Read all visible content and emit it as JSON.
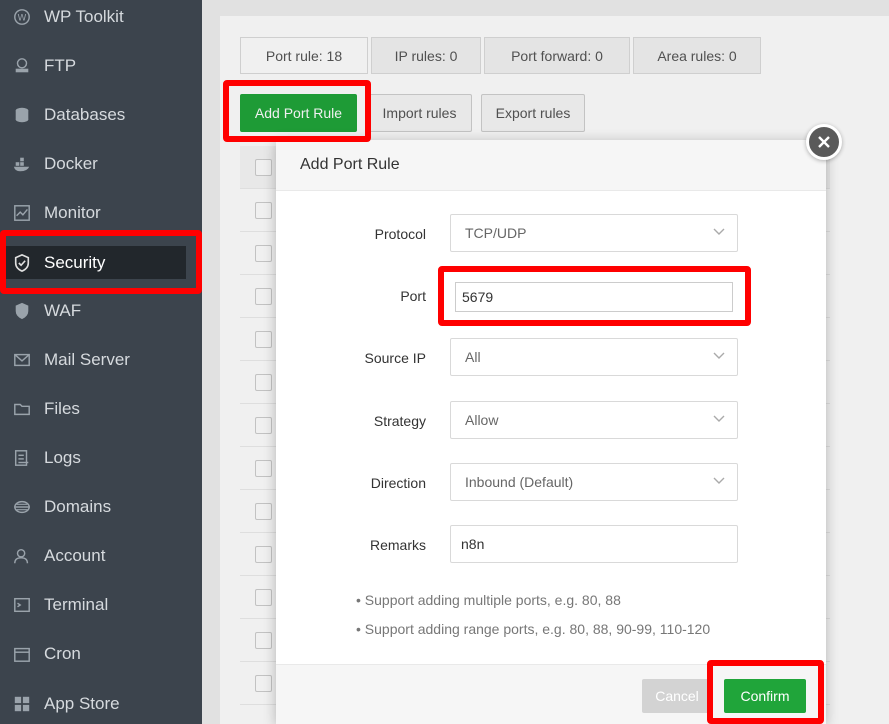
{
  "sidebar": {
    "items": [
      {
        "label": "WP Toolkit",
        "icon": "wordpress-icon"
      },
      {
        "label": "FTP",
        "icon": "ftp-icon"
      },
      {
        "label": "Databases",
        "icon": "database-icon"
      },
      {
        "label": "Docker",
        "icon": "docker-icon"
      },
      {
        "label": "Monitor",
        "icon": "monitor-icon"
      },
      {
        "label": "Security",
        "icon": "shield-icon"
      },
      {
        "label": "WAF",
        "icon": "waf-shield-icon"
      },
      {
        "label": "Mail Server",
        "icon": "mail-icon"
      },
      {
        "label": "Files",
        "icon": "folder-icon"
      },
      {
        "label": "Logs",
        "icon": "logs-icon"
      },
      {
        "label": "Domains",
        "icon": "globe-icon"
      },
      {
        "label": "Account",
        "icon": "user-icon"
      },
      {
        "label": "Terminal",
        "icon": "terminal-icon"
      },
      {
        "label": "Cron",
        "icon": "calendar-icon"
      },
      {
        "label": "App Store",
        "icon": "grid-icon"
      }
    ],
    "active": "Security"
  },
  "tabs": [
    {
      "label": "Port rule: 18"
    },
    {
      "label": "IP rules: 0"
    },
    {
      "label": "Port forward: 0"
    },
    {
      "label": "Area rules: 0"
    }
  ],
  "toolbar": {
    "add_label": "Add Port Rule",
    "import_label": "Import rules",
    "export_label": "Export rules"
  },
  "modal": {
    "title": "Add Port Rule",
    "fields": {
      "protocol": {
        "label": "Protocol",
        "value": "TCP/UDP"
      },
      "port": {
        "label": "Port",
        "value": "5679"
      },
      "source_ip": {
        "label": "Source IP",
        "value": "All"
      },
      "strategy": {
        "label": "Strategy",
        "value": "Allow"
      },
      "direction": {
        "label": "Direction",
        "value": "Inbound (Default)"
      },
      "remarks": {
        "label": "Remarks",
        "value": "n8n"
      }
    },
    "tips": [
      "Support adding multiple ports, e.g. 80, 88",
      "Support adding range ports, e.g. 80, 88, 90-99, 110-120"
    ],
    "cancel_label": "Cancel",
    "confirm_label": "Confirm"
  },
  "colors": {
    "sidebar_bg": "#3c444d",
    "accent_green": "#20a53a",
    "highlight_red": "#ff0000"
  }
}
